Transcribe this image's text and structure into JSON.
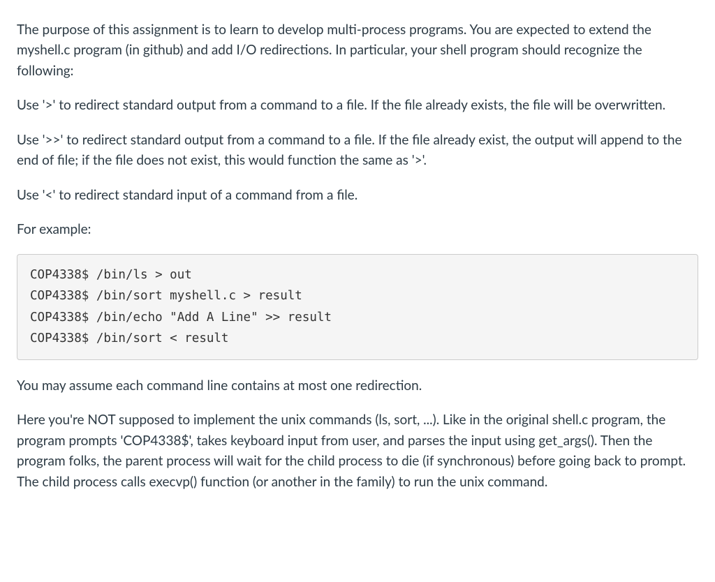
{
  "paragraphs": {
    "intro": "The purpose of this assignment is to learn to develop multi-process programs. You are expected to extend the myshell.c program (in github) and add I/O redirections. In particular, your shell program should recognize the following:",
    "redirect_out": "Use '>' to redirect standard output from a command to a file. If the file already exists, the file will be overwritten.",
    "redirect_append": "Use '>>' to redirect standard output from a command to a file. If the file already exist, the output will append to the end of file; if the file does not exist, this would function the same as '>'.",
    "redirect_in": "Use '<' to redirect standard input of a command from a file.",
    "example_label": "For example:",
    "assume": "You may assume each command line contains at most one redirection.",
    "explain": "Here you're NOT supposed to implement the unix commands (ls, sort, ...). Like in the original shell.c program, the program prompts 'COP4338$', takes keyboard input from user, and parses the input using get_args(). Then the program folks, the parent process will wait for the child process to die (if synchronous) before going back to prompt. The child process calls execvp() function (or another in the family) to run the unix command."
  },
  "code_example": "COP4338$ /bin/ls > out\nCOP4338$ /bin/sort myshell.c > result\nCOP4338$ /bin/echo \"Add A Line\" >> result\nCOP4338$ /bin/sort < result"
}
